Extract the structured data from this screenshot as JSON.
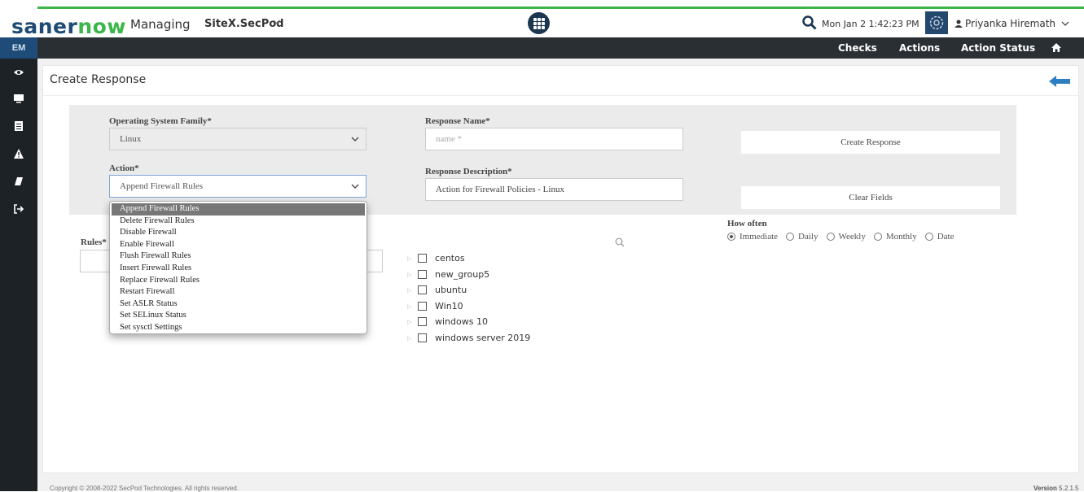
{
  "header": {
    "logo_part1": "saner",
    "logo_part2": "now",
    "managing_label": "Managing",
    "site_name": "SiteX.SecPod",
    "datetime": "Mon Jan 2  1:42:23 PM",
    "user_name": "Priyanka Hiremath",
    "icons": [
      "apps-grid-icon",
      "search-icon",
      "gear-icon",
      "user-icon",
      "chevron-down-icon"
    ]
  },
  "navbar": {
    "module_label": "EM",
    "links": [
      "Checks",
      "Actions",
      "Action Status"
    ],
    "home_icon": "home-icon"
  },
  "sidebar": {
    "items": [
      "eye-icon",
      "monitor-icon",
      "document-icon",
      "warning-icon",
      "eraser-icon",
      "logout-icon"
    ]
  },
  "page": {
    "title": "Create Response",
    "back_icon": "arrow-left-icon"
  },
  "form": {
    "os_family_label": "Operating System Family*",
    "os_family_value": "Linux",
    "action_label": "Action*",
    "action_value": "Append Firewall Rules",
    "response_name_label": "Response Name*",
    "response_name_placeholder": "name *",
    "response_desc_label": "Response Description*",
    "response_desc_value": "Action for Firewall Policies - Linux",
    "create_button": "Create Response",
    "clear_button": "Clear Fields",
    "rules_label": "Rules*"
  },
  "action_dropdown": {
    "options": [
      "Append Firewall Rules",
      "Delete Firewall Rules",
      "Disable Firewall",
      "Enable Firewall",
      "Flush Firewall Rules",
      "Insert Firewall Rules",
      "Replace Firewall Rules",
      "Restart Firewall",
      "Set ASLR Status",
      "Set SELinux Status",
      "Set sysctl Settings"
    ],
    "selected": "Append Firewall Rules"
  },
  "groups": {
    "items": [
      "centos",
      "new_group5",
      "ubuntu",
      "Win10",
      "windows 10",
      "windows server 2019"
    ]
  },
  "schedule": {
    "label": "How often",
    "options": [
      "Immediate",
      "Daily",
      "Weekly",
      "Monthly",
      "Date"
    ],
    "selected": "Immediate"
  },
  "footer": {
    "copyright": "Copyright © 2008-2022 SecPod Technologies. All rights reserved.",
    "version_label": "Version",
    "version_number": "5.2.1.5"
  },
  "colors": {
    "brand_green": "#3cb54a",
    "brand_blue": "#1e4b73",
    "nav_dark": "#2a2f34",
    "sidebar_dark": "#1d2226"
  }
}
